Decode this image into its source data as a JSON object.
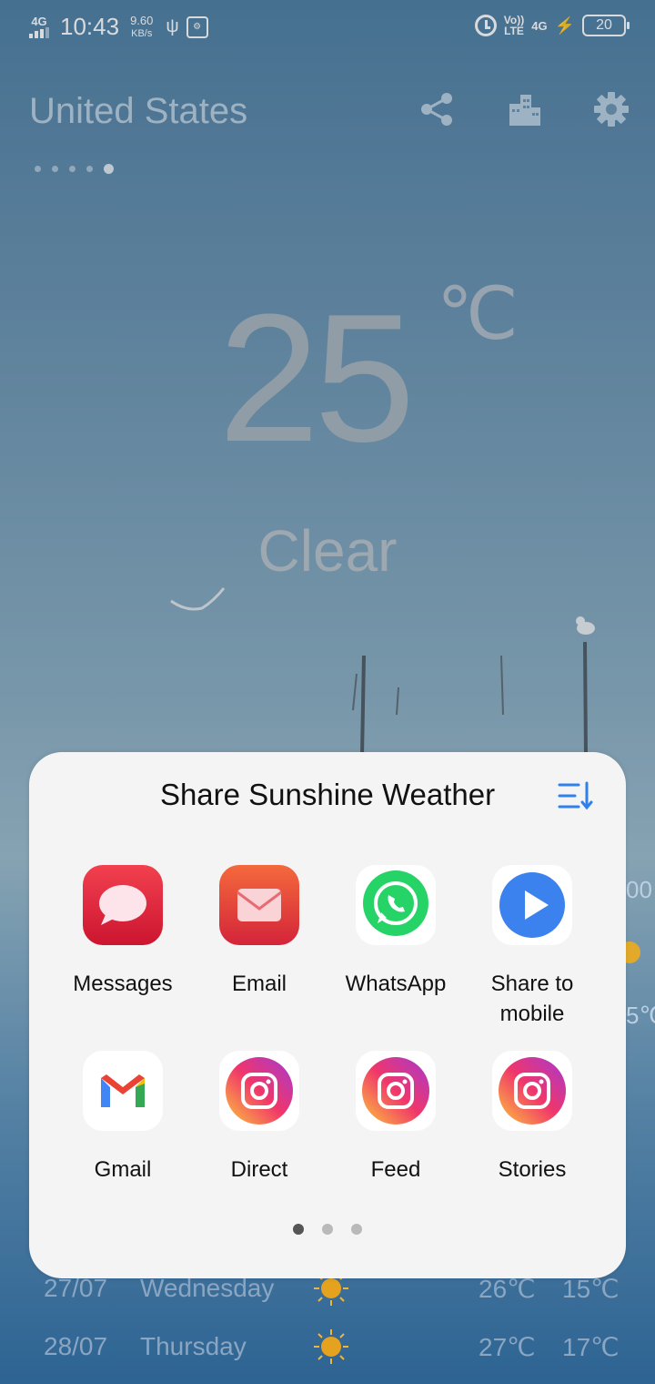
{
  "status_bar": {
    "network": "4G",
    "time": "10:43",
    "speed_value": "9.60",
    "speed_unit": "KB/s",
    "volte_top": "Vo))",
    "volte_bottom": "LTE",
    "network_right": "4G",
    "battery": "20"
  },
  "header": {
    "location": "United States",
    "page_dots": 5,
    "active_dot": 5
  },
  "weather": {
    "temperature": "25",
    "unit": "℃",
    "condition": "Clear"
  },
  "background_peek": {
    "right_top": "00",
    "right_bottom": "5℃"
  },
  "forecast": [
    {
      "date": "27/07",
      "day": "Wednesday",
      "high": "26℃",
      "low": "15℃",
      "icon": "sun-icon"
    },
    {
      "date": "28/07",
      "day": "Thursday",
      "high": "27℃",
      "low": "17℃",
      "icon": "sun-icon"
    }
  ],
  "share_sheet": {
    "title": "Share Sunshine Weather",
    "apps": [
      {
        "label": "Messages",
        "icon": "messages-icon"
      },
      {
        "label": "Email",
        "icon": "email-icon"
      },
      {
        "label": "WhatsApp",
        "icon": "whatsapp-icon"
      },
      {
        "label": "Share to mobile",
        "icon": "share-to-mobile-icon"
      },
      {
        "label": "Gmail",
        "icon": "gmail-icon"
      },
      {
        "label": "Direct",
        "icon": "instagram-icon"
      },
      {
        "label": "Feed",
        "icon": "instagram-icon"
      },
      {
        "label": "Stories",
        "icon": "instagram-icon"
      }
    ],
    "pages": 3,
    "active_page": 1
  },
  "colors": {
    "sheet_background": "#f4f4f4",
    "accent_blue": "#2f80ed",
    "whatsapp_green": "#25d366",
    "messages_red": "#e8243c"
  }
}
